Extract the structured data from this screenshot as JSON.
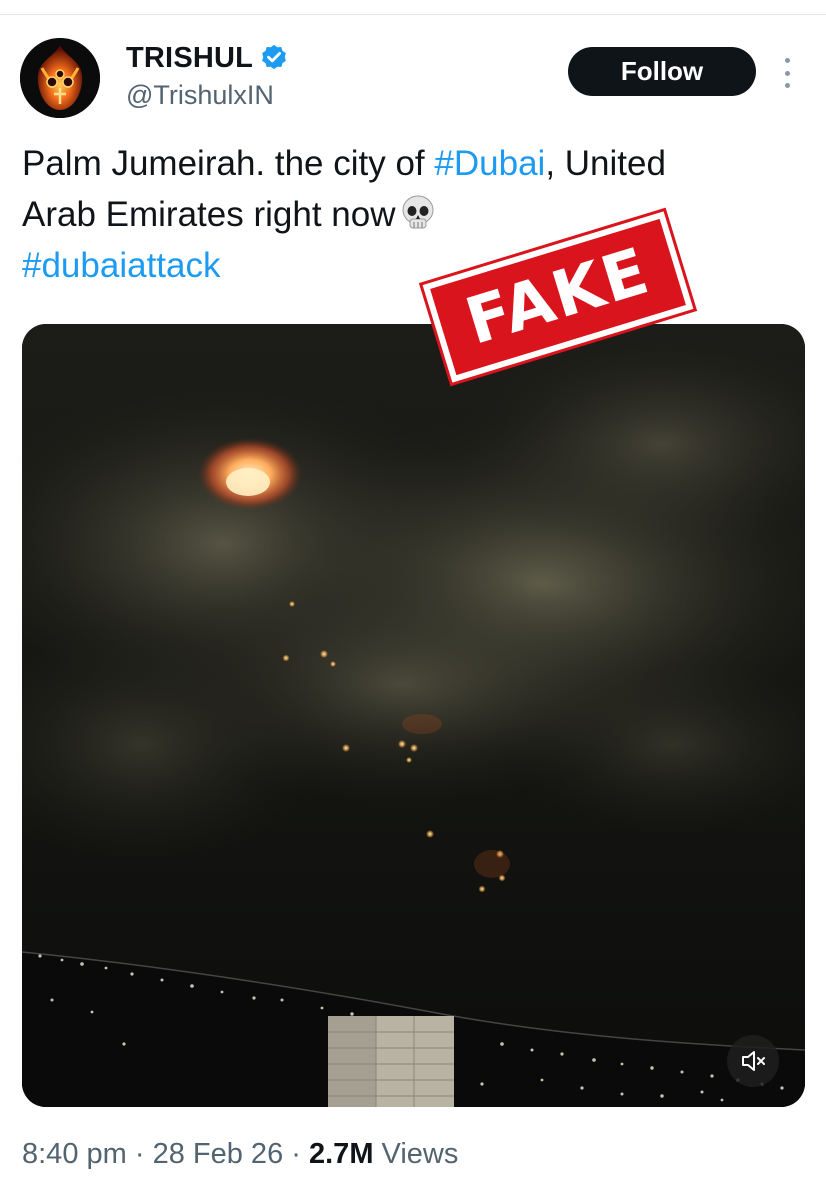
{
  "author": {
    "name": "TRISHUL",
    "handle": "@TrishulxIN",
    "verified": true,
    "avatar_icon": "trishul-flame-avatar"
  },
  "actions": {
    "follow_label": "Follow",
    "more_icon": "more-dots-icon"
  },
  "tweet": {
    "line1_text": "Palm Jumeirah. the city of ",
    "line1_hashtag": "#Dubai",
    "line1_after": ", United",
    "line2_text": "Arab Emirates right now",
    "emoji": "skull-emoji",
    "line3_hashtag": "#dubaiattack"
  },
  "overlay": {
    "stamp_label": "FAKE",
    "stamp_color": "#d9141c"
  },
  "media": {
    "type": "video",
    "mute_icon": "muted-speaker-icon"
  },
  "meta": {
    "time": "8:40 pm",
    "date": "28 Feb 26",
    "views_count": "2.7M",
    "views_label": "Views",
    "separator": "·"
  },
  "colors": {
    "link": "#1d9bf0",
    "text": "#0f1419",
    "secondary": "#536471",
    "follow_bg": "#0f1419"
  }
}
